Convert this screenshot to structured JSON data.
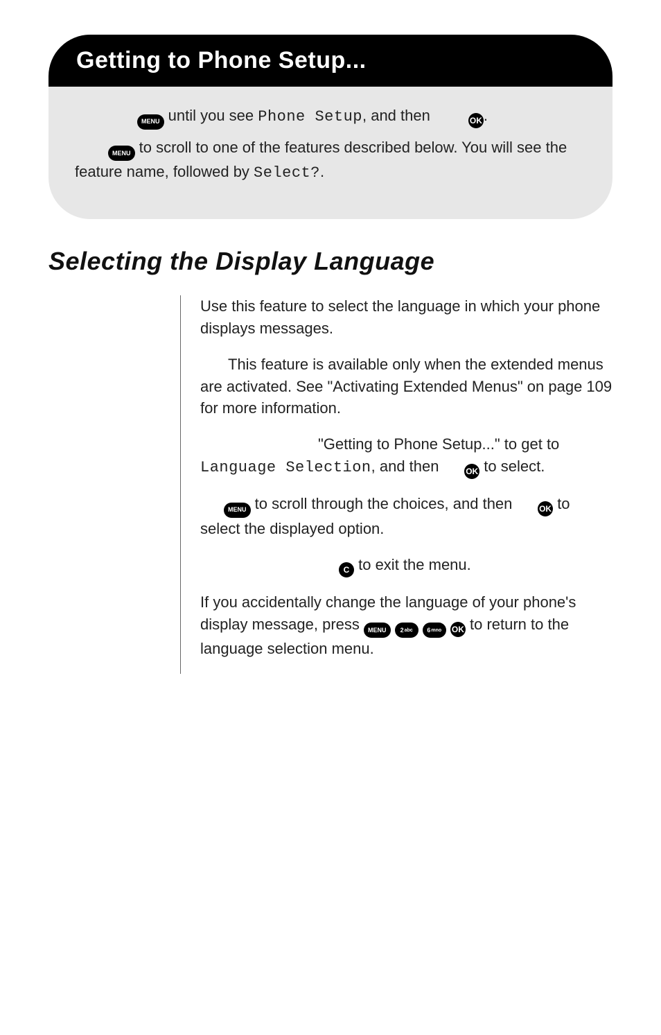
{
  "banner": {
    "title": "Getting to Phone Setup..."
  },
  "grey": {
    "line1_pre": " until you see ",
    "line1_phone_setup": "Phone Setup",
    "line1_mid": ", and then ",
    "line1_post": ".",
    "line2_pre": " to scroll to one of the features described below. You will see the feature name, followed by ",
    "line2_select": "Select?",
    "line2_post": "."
  },
  "section": {
    "heading": "Selecting the Display Language"
  },
  "body": {
    "p1": "Use this feature to select the language in which your phone displays messages.",
    "p2_pre": "This feature is available only when the extended menus are activated. See \"Activating Extended Menus\" on page 109 for more information.",
    "step1_pre": "\"Getting to Phone Setup...\" to get to ",
    "step1_lang": "Language Selection",
    "step1_mid": ", and then ",
    "step1_post": " to select.",
    "step2_pre": " to scroll through the choices, and then ",
    "step2_post": " to select the displayed option.",
    "step3_post": " to exit the menu.",
    "p3_pre": "If you accidentally change the language of your phone's display message, press ",
    "p3_post": " to return to the language selection menu."
  },
  "icons": {
    "menu": "MENU",
    "ok": "OK",
    "c": "C",
    "two": "2",
    "two_sub": "abc",
    "six": "6",
    "six_sub": "mno"
  }
}
